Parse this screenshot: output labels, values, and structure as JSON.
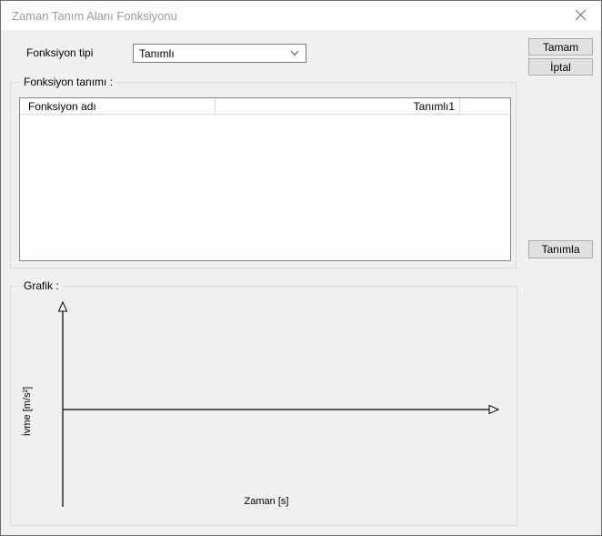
{
  "window": {
    "title": "Zaman Tanım Alanı Fonksiyonu"
  },
  "function_type": {
    "label": "Fonksiyon tipi",
    "selected_value": "Tanımlı"
  },
  "buttons": {
    "ok_label": "Tamam",
    "cancel_label": "İptal",
    "define_label": "Tanımla"
  },
  "function_definition": {
    "group_label": "Fonksiyon tanımı :",
    "table": {
      "columns": [
        {
          "label": "Fonksiyon adı",
          "align": "left"
        },
        {
          "label": "Tanımlı1",
          "align": "right"
        }
      ],
      "rows": []
    }
  },
  "graph": {
    "group_label": "Grafik :",
    "y_axis_label": "İvme [m/s²]",
    "x_axis_label": "Zaman [s]",
    "series": []
  },
  "colors": {
    "dialog_bg": "#f0f0f0",
    "titlebar_bg": "#ffffff",
    "title_text": "#9a9c9e",
    "button_bg": "#e1e1e1",
    "button_border": "#adadad",
    "control_border": "#7a7a7a",
    "groupbox_border": "#dcdcdc",
    "listview_border": "#828790",
    "axis_color": "#000000"
  }
}
